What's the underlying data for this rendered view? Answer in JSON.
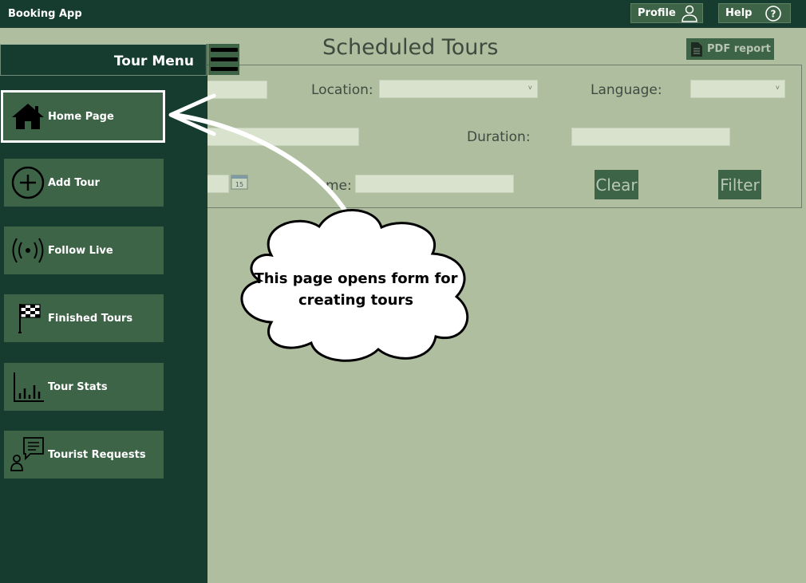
{
  "app": {
    "title": "Booking App"
  },
  "header": {
    "profile_label": "Profile",
    "help_label": "Help",
    "page_title": "Scheduled Tours",
    "pdf_label": "PDF report"
  },
  "filters": {
    "location_label": "Location:",
    "language_label": "Language:",
    "duration_label": "Duration:",
    "time_label": "me:",
    "clear_label": "Clear",
    "filter_label": "Filter"
  },
  "sidebar": {
    "title": "Tour Menu",
    "items": [
      {
        "label": "Home Page",
        "icon": "home-icon"
      },
      {
        "label": "Add Tour",
        "icon": "plus-circle-icon"
      },
      {
        "label": "Follow Live",
        "icon": "broadcast-icon"
      },
      {
        "label": "Finished Tours",
        "icon": "checkered-flag-icon"
      },
      {
        "label": "Tour Stats",
        "icon": "bar-chart-icon"
      },
      {
        "label": "Tourist Requests",
        "icon": "person-message-icon"
      }
    ]
  },
  "callout": {
    "line1": "This page opens form for",
    "line2": "creating tours"
  },
  "colors": {
    "topbar": "#153c2e",
    "background": "#b0bea0",
    "button": "#3e6448",
    "field": "#d9e2cc"
  }
}
